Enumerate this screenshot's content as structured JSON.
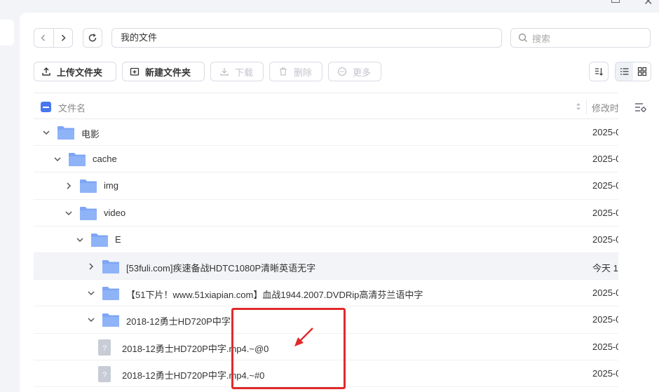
{
  "window": {
    "restore_icon": "restore-icon",
    "close_symbol": "✕"
  },
  "nav": {
    "back_icon": "chevron-left-icon",
    "forward_icon": "chevron-right-icon",
    "refresh_icon": "refresh-icon"
  },
  "path": {
    "value": "我的文件"
  },
  "search": {
    "placeholder": "搜索"
  },
  "toolbar": {
    "upload_label": "上传文件夹",
    "new_folder_label": "新建文件夹",
    "download_label": "下载",
    "delete_label": "删除",
    "more_label": "更多"
  },
  "table": {
    "col_name": "文件名",
    "col_time": "修改时",
    "rows": [
      {
        "name": "电影",
        "type": "folder",
        "expanded": true,
        "level": 0,
        "time": "2025-0"
      },
      {
        "name": "cache",
        "type": "folder",
        "expanded": true,
        "level": 1,
        "time": "2025-0"
      },
      {
        "name": "img",
        "type": "folder",
        "expanded": false,
        "level": 2,
        "time": "2025-0"
      },
      {
        "name": "video",
        "type": "folder",
        "expanded": true,
        "level": 2,
        "time": "2025-0"
      },
      {
        "name": "E",
        "type": "folder",
        "expanded": true,
        "level": 3,
        "time": "2025-0"
      },
      {
        "name": "[53fuli.com]疾速备战HDTC1080P清晰英语无字",
        "type": "folder",
        "expanded": false,
        "level": 4,
        "time": "今天 1",
        "hover": true
      },
      {
        "name": "【51下片！www.51xiapian.com】血战1944.2007.DVDRip高清芬兰语中字",
        "type": "folder",
        "expanded": true,
        "level": 4,
        "time": "2025-0"
      },
      {
        "name": "2018-12勇士HD720P中字",
        "type": "folder",
        "expanded": true,
        "level": 4,
        "time": "2025-0"
      },
      {
        "name": "2018-12勇士HD720P中字.mp4.~@0",
        "type": "unknown-file",
        "level": 5,
        "time": "2025-0"
      },
      {
        "name": "2018-12勇士HD720P中字.mp4.~#0",
        "type": "unknown-file",
        "level": 5,
        "time": "2025-0"
      }
    ]
  },
  "colors": {
    "accent": "#4777f0",
    "folder": "#8fb3f7",
    "annotation": "#e02a2a"
  }
}
